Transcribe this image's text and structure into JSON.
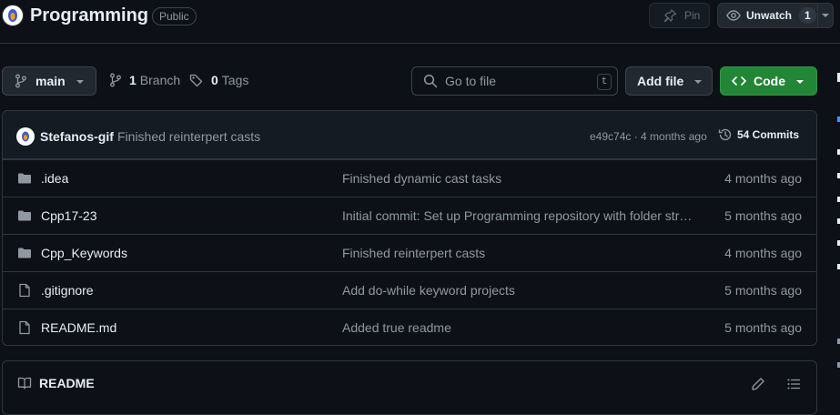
{
  "repo": {
    "name": "Programming",
    "visibility": "Public",
    "pin_label": "Pin",
    "watch_label": "Unwatch",
    "watch_count": "1"
  },
  "toolbar": {
    "branch": "main",
    "branch_count": "1",
    "branch_label": "Branch",
    "tag_count": "0",
    "tag_label": "Tags",
    "search_placeholder": "Go to file",
    "search_shortcut": "t",
    "add_file_label": "Add file",
    "code_label": "Code"
  },
  "commit": {
    "author": "Stefanos-gif",
    "message": "Finished reinterpert casts",
    "hash_age": "e49c74c · 4 months ago",
    "commit_count": "54 Commits"
  },
  "files": [
    {
      "name": ".idea",
      "type": "folder",
      "message": "Finished dynamic cast tasks",
      "age": "4 months ago"
    },
    {
      "name": "Cpp17-23",
      "type": "folder",
      "message": "Initial commit: Set up Programming repository with folder structure",
      "age": "5 months ago"
    },
    {
      "name": "Cpp_Keywords",
      "type": "folder",
      "message": "Finished reinterpert casts",
      "age": "4 months ago"
    },
    {
      "name": ".gitignore",
      "type": "file",
      "message": "Add do-while keyword projects",
      "age": "5 months ago"
    },
    {
      "name": "README.md",
      "type": "file",
      "message": "Added true readme",
      "age": "5 months ago"
    }
  ],
  "readme": {
    "title": "README"
  },
  "colors": {
    "background": "#0d1117",
    "border": "#30363d",
    "code_button": "#238636",
    "muted_text": "#9198a1"
  },
  "icons": {
    "branch": "git-branch-icon",
    "tag": "tag-icon",
    "search": "search-icon",
    "folder": "folder-icon",
    "file": "file-icon",
    "history": "history-icon",
    "book": "book-icon",
    "pencil": "pencil-icon",
    "toc": "list-icon",
    "eye": "eye-icon",
    "pin": "pin-icon"
  }
}
